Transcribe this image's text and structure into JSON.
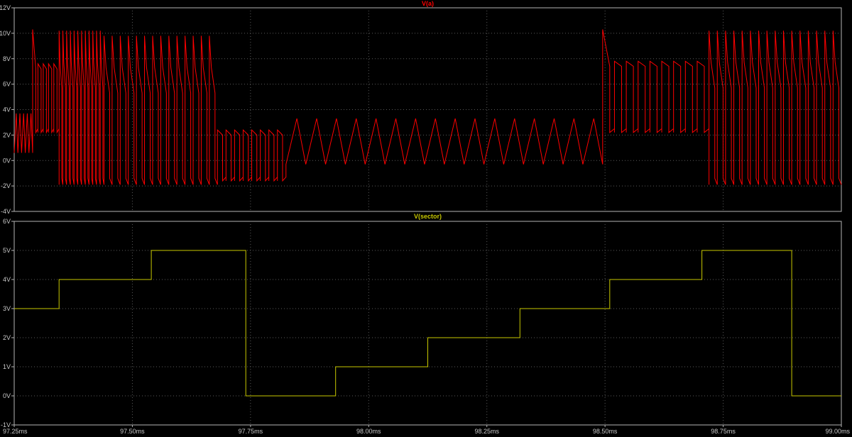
{
  "chart_data": [
    {
      "type": "line",
      "title": "V(a)",
      "series": [
        {
          "name": "V(a)",
          "color": "#ff0000"
        }
      ],
      "ylim": [
        -4,
        12
      ],
      "yticks": [
        12,
        10,
        8,
        6,
        4,
        2,
        0,
        -2,
        -4
      ],
      "ytick_labels": [
        "12V",
        "10V",
        "8V",
        "6V",
        "4V",
        "2V",
        "0V",
        "-2V",
        "-4V"
      ],
      "grid": true,
      "note_segments": [
        {
          "x0": 97.25,
          "x1": 97.289,
          "mode": "saw",
          "low": 0.6,
          "high": 3.7,
          "teeth": 5
        },
        {
          "x0": 97.289,
          "x1": 97.345,
          "mode": "pulse",
          "base": 2.2,
          "top": 7.6,
          "pulses": 5,
          "spike": 10.3
        },
        {
          "x0": 97.345,
          "x1": 97.44,
          "mode": "pwm",
          "low": -1.9,
          "high": 10.2,
          "pulses": 12
        },
        {
          "x0": 97.44,
          "x1": 97.68,
          "mode": "pwm",
          "low": -1.9,
          "high": 9.8,
          "pulses": 14
        },
        {
          "x0": 97.68,
          "x1": 97.825,
          "mode": "pulse",
          "base": -1.6,
          "top": 2.4,
          "pulses": 8
        },
        {
          "x0": 97.825,
          "x1": 98.495,
          "mode": "saw",
          "low": -0.3,
          "high": 3.3,
          "teeth": 16
        },
        {
          "x0": 98.495,
          "x1": 98.72,
          "mode": "pulse",
          "base": 2.2,
          "top": 7.8,
          "pulses": 9,
          "spike": 10.3
        },
        {
          "x0": 98.72,
          "x1": 99.0,
          "mode": "pwm",
          "low": -1.9,
          "high": 10.2,
          "pulses": 16
        }
      ]
    },
    {
      "type": "line",
      "title": "V(sector)",
      "series": [
        {
          "name": "V(sector)",
          "color": "#c8c800"
        }
      ],
      "x": [
        97.25,
        97.345,
        97.345,
        97.54,
        97.54,
        97.74,
        97.74,
        97.93,
        97.93,
        98.125,
        98.125,
        98.32,
        98.32,
        98.51,
        98.51,
        98.705,
        98.705,
        98.895,
        98.895,
        99.0
      ],
      "y": [
        3,
        3,
        4,
        4,
        5,
        5,
        0,
        0,
        1,
        1,
        2,
        2,
        3,
        3,
        4,
        4,
        5,
        5,
        0,
        0
      ],
      "ylim": [
        -1,
        6
      ],
      "yticks": [
        6,
        5,
        4,
        3,
        2,
        1,
        0,
        -1
      ],
      "ytick_labels": [
        "6V",
        "5V",
        "4V",
        "3V",
        "2V",
        "1V",
        "0V",
        "-1V"
      ],
      "grid": true
    }
  ],
  "x_axis": {
    "range": [
      97.25,
      99.0
    ],
    "ticks": [
      97.25,
      97.5,
      97.75,
      98.0,
      98.25,
      98.5,
      98.75,
      99.0
    ],
    "tick_labels": [
      "97.25ms",
      "97.50ms",
      "97.75ms",
      "98.00ms",
      "98.25ms",
      "98.50ms",
      "98.75ms",
      "99.00ms"
    ]
  }
}
